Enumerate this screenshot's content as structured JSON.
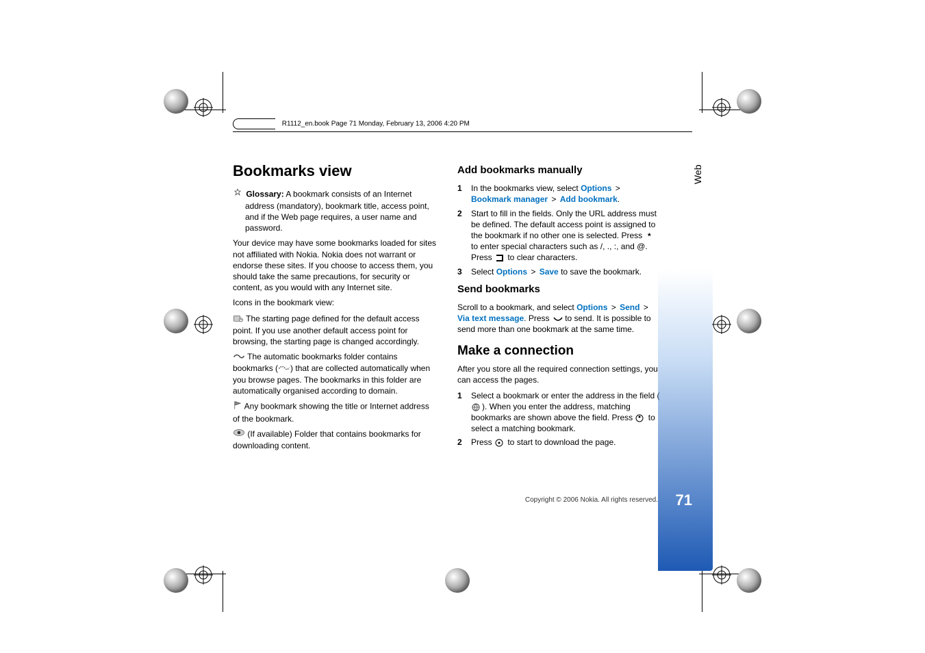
{
  "header": "R1112_en.book  Page 71  Monday, February 13, 2006  4:20 PM",
  "side_tab": "Web",
  "page_number": "71",
  "copyright": "Copyright © 2006 Nokia. All rights reserved.",
  "left": {
    "h2": "Bookmarks view",
    "glossary_label": "Glossary:",
    "glossary_text": " A bookmark consists of an Internet address (mandatory), bookmark title, access point, and if the Web page requires, a user name and password.",
    "p1": "Your device may have some bookmarks loaded for sites not affiliated with Nokia. Nokia does not warrant or endorse these sites. If you choose to access them, you should take the same precautions, for security or content, as you would with any Internet site.",
    "p2": "Icons in the bookmark view:",
    "icon1": " The starting page defined for the default access point. If you use another default access point for browsing, the starting page is changed accordingly.",
    "icon2a": " The automatic bookmarks folder contains bookmarks (",
    "icon2b": ") that are collected automatically when you browse pages. The bookmarks in this folder are automatically organised according to domain.",
    "icon3": " Any bookmark showing the title or Internet address of the bookmark.",
    "icon4": " (If available) Folder that contains bookmarks for downloading content."
  },
  "right": {
    "h3a": "Add bookmarks manually",
    "step1_a": "In the bookmarks view, select ",
    "options": "Options",
    "bookmark_manager": "Bookmark manager",
    "add_bookmark": "Add bookmark",
    "step2_a": "Start to fill in the fields. Only the URL address must be defined. The default access point is assigned to the bookmark if no other one is selected. Press ",
    "step2_b": " to enter special characters such as /, ., :, and @. Press ",
    "step2_c": " to clear characters.",
    "step3_a": "Select ",
    "save": "Save",
    "step3_b": " to save the bookmark.",
    "h3b": "Send bookmarks",
    "send_p_a": "Scroll to a bookmark, and select ",
    "send": "Send",
    "via_text": "Via text message",
    "send_p_b": ". Press ",
    "send_p_c": " to send. It is possible to send more than one bookmark at the same time.",
    "h2b": "Make a connection",
    "mc_p": "After you store all the required connection settings, you can access the pages.",
    "mc1_a": "Select a bookmark or enter the address in the field (",
    "mc1_b": "). When you enter the address, matching bookmarks are shown above the field. Press ",
    "mc1_c": " to select a matching bookmark.",
    "mc2_a": "Press ",
    "mc2_b": " to start to download the page."
  }
}
